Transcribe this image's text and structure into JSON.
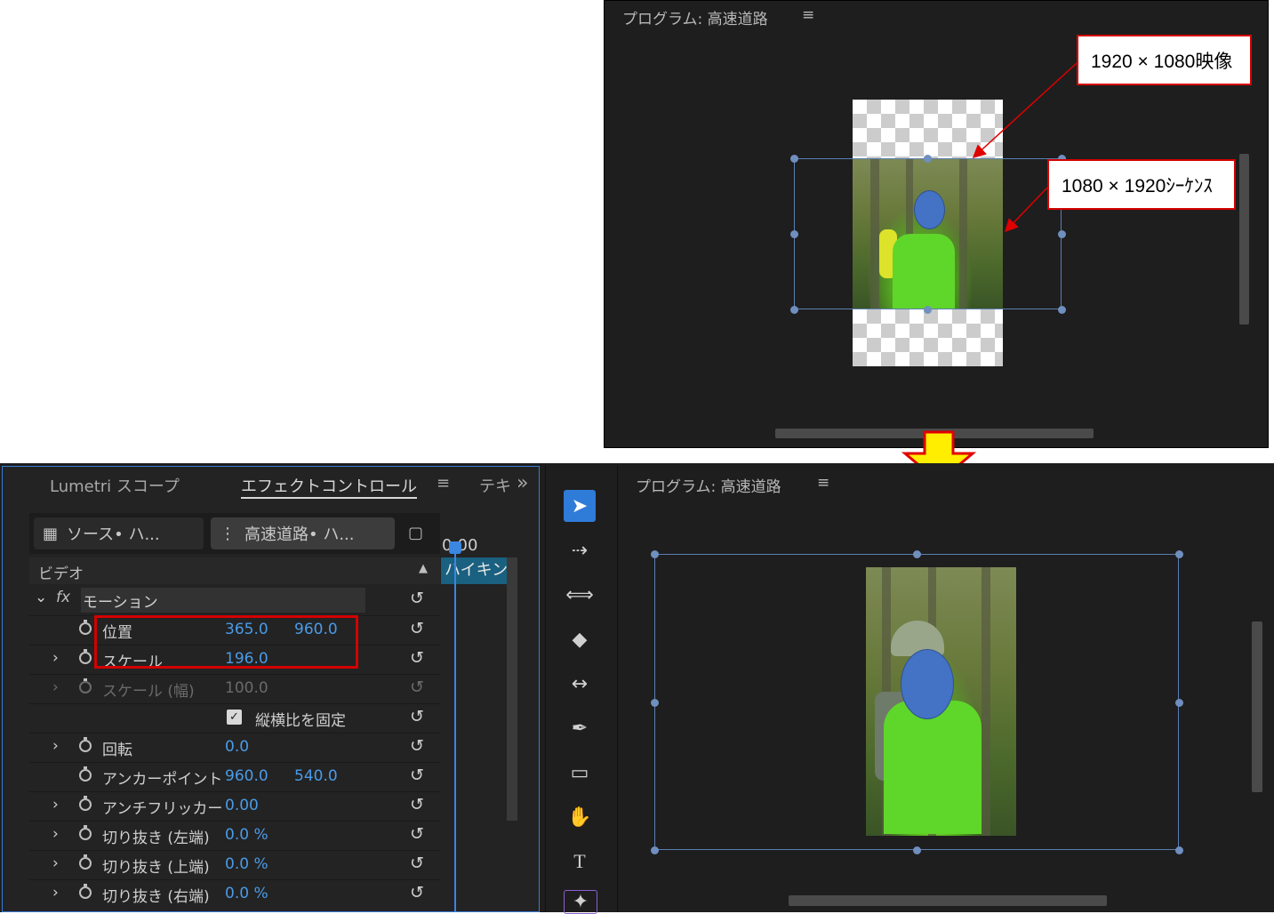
{
  "top_monitor": {
    "title": "プログラム: 高速道路",
    "menu_icon": "≡",
    "callout_video": "1920 × 1080映像",
    "callout_sequence": "1080 × 1920ｼｰｹﾝｽ"
  },
  "bottom_effect_panel": {
    "tabs": [
      "Lumetri スコープ",
      "エフェクトコントロール",
      "テキ"
    ],
    "tab_menu_icon": "≡",
    "overflow_icon": "»",
    "source_clip": "ソース• ハ...",
    "sequence_clip": "高速道路• ハ...",
    "timeline_time": "0:00",
    "timeline_clip": "ハイキン",
    "section_video": "ビデオ",
    "fx_label": "fx",
    "motion_label": "モーション",
    "properties": [
      {
        "label": "位置",
        "v1": "365.0",
        "v2": "960.0",
        "chevron": "",
        "disabled": false
      },
      {
        "label": "スケール",
        "v1": "196.0",
        "v2": "",
        "chevron": "›",
        "disabled": false
      },
      {
        "label": "スケール (幅)",
        "v1": "100.0",
        "v2": "",
        "chevron": "›",
        "disabled": true
      },
      {
        "label": "縦横比を固定",
        "v1": "",
        "v2": "",
        "chevron": "",
        "disabled": false,
        "checkbox": true
      },
      {
        "label": "回転",
        "v1": "0.0",
        "v2": "",
        "chevron": "›",
        "disabled": false
      },
      {
        "label": "アンカーポイント",
        "v1": "960.0",
        "v2": "540.0",
        "chevron": "",
        "disabled": false
      },
      {
        "label": "アンチフリッカー",
        "v1": "0.00",
        "v2": "",
        "chevron": "›",
        "disabled": false
      },
      {
        "label": "切り抜き (左端)",
        "v1": "0.0 %",
        "v2": "",
        "chevron": "›",
        "disabled": false
      },
      {
        "label": "切り抜き (上端)",
        "v1": "0.0 %",
        "v2": "",
        "chevron": "›",
        "disabled": false
      },
      {
        "label": "切り抜き (右端)",
        "v1": "0.0 %",
        "v2": "",
        "chevron": "›",
        "disabled": false
      }
    ],
    "reset_icon": "↺"
  },
  "bottom_monitor": {
    "title": "プログラム: 高速道路",
    "menu_icon": "≡"
  },
  "toolbar": {
    "tools": [
      "selection-tool",
      "track-select-tool",
      "ripple-edit-tool",
      "razor-tool",
      "slip-tool",
      "pen-tool",
      "rectangle-tool",
      "hand-tool",
      "type-tool",
      "remix-tool"
    ]
  },
  "colors": {
    "panel_bg": "#1e1e1e",
    "accent_blue": "#2f7bd8",
    "value_blue": "#4a9be8",
    "callout_red": "#d40000",
    "arrow_yellow": "#ffee00"
  }
}
